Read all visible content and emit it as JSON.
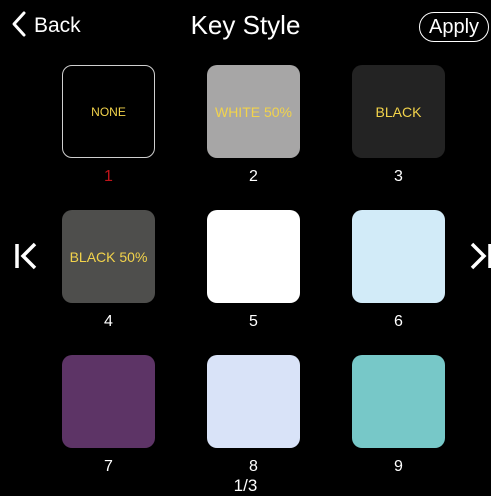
{
  "header": {
    "back_label": "Back",
    "title": "Key Style",
    "apply_label": "Apply"
  },
  "styles": [
    {
      "label": "NONE",
      "number": "1",
      "color": "#000000",
      "selected": true
    },
    {
      "label": "WHITE 50%",
      "number": "2",
      "color": "#a7a6a6"
    },
    {
      "label": "BLACK",
      "number": "3",
      "color": "#232323"
    },
    {
      "label": "BLACK 50%",
      "number": "4",
      "color": "#4e4e4c"
    },
    {
      "label": "",
      "number": "5",
      "color": "#ffffff"
    },
    {
      "label": "",
      "number": "6",
      "color": "#d2ebf8"
    },
    {
      "label": "",
      "number": "7",
      "color": "#5d3466"
    },
    {
      "label": "",
      "number": "8",
      "color": "#d9e3f8"
    },
    {
      "label": "",
      "number": "9",
      "color": "#77c8c8"
    }
  ],
  "pagination": {
    "current": "1/3"
  },
  "icons": {
    "back": "chevron-left-icon",
    "prev": "first-page-icon",
    "next": "last-page-icon"
  },
  "colors": {
    "selected_number": "#c0141a",
    "label_text": "#f2d34b"
  }
}
